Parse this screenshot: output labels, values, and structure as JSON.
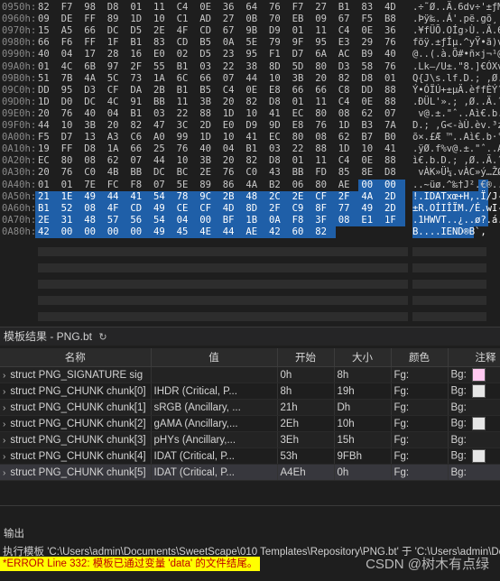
{
  "hex": {
    "rows": [
      {
        "addr": "0950h:",
        "bytes": [
          "82",
          "F7",
          "98",
          "D8",
          "01",
          "11",
          "C4",
          "0E",
          "36",
          "64",
          "76",
          "F7",
          "27",
          "B1",
          "83",
          "4D"
        ],
        "ascii": ".÷˜Ø..Ä.6dv÷'±ƒM"
      },
      {
        "addr": "0960h:",
        "bytes": [
          "09",
          "DE",
          "FF",
          "89",
          "1D",
          "10",
          "C1",
          "AD",
          "27",
          "0B",
          "70",
          "EB",
          "09",
          "67",
          "F5",
          "B8"
        ],
        "ascii": ".Þÿ‰..Á­'.pë.gõ¸"
      },
      {
        "addr": "0970h:",
        "bytes": [
          "15",
          "A5",
          "66",
          "DC",
          "D5",
          "2E",
          "4F",
          "CD",
          "67",
          "9B",
          "D9",
          "01",
          "11",
          "C4",
          "0E",
          "36"
        ],
        "ascii": ".¥fÜÕ.OÍg›Ù..Ä.6"
      },
      {
        "addr": "0980h:",
        "bytes": [
          "66",
          "F6",
          "FF",
          "1F",
          "B1",
          "83",
          "CD",
          "B5",
          "0A",
          "5E",
          "79",
          "9F",
          "95",
          "E3",
          "29",
          "76"
        ],
        "ascii": "föÿ.±ƒÍµ.^yŸ•ã)v"
      },
      {
        "addr": "0990h:",
        "bytes": [
          "40",
          "04",
          "17",
          "28",
          "16",
          "E0",
          "02",
          "D5",
          "23",
          "95",
          "F1",
          "D7",
          "6A",
          "AC",
          "B9",
          "40"
        ],
        "ascii": "@..(.à.Õ#•ñ×j¬¹@"
      },
      {
        "addr": "09A0h:",
        "bytes": [
          "01",
          "4C",
          "6B",
          "97",
          "2F",
          "55",
          "B1",
          "03",
          "22",
          "38",
          "8D",
          "5D",
          "80",
          "D3",
          "58",
          "76"
        ],
        "ascii": ".Lk—/U±.\"8.]€ÓXv"
      },
      {
        "addr": "09B0h:",
        "bytes": [
          "51",
          "7B",
          "4A",
          "5C",
          "73",
          "1A",
          "6C",
          "66",
          "07",
          "44",
          "10",
          "3B",
          "20",
          "82",
          "D8",
          "01"
        ],
        "ascii": "Q{J\\s.lf.D.; ‚Ø."
      },
      {
        "addr": "09C0h:",
        "bytes": [
          "DD",
          "95",
          "D3",
          "CF",
          "DA",
          "2B",
          "B1",
          "B5",
          "C4",
          "0E",
          "E8",
          "66",
          "66",
          "C8",
          "DD",
          "88"
        ],
        "ascii": "Ý•ÓÏÚ+±µÄ.èffÈÝˆ"
      },
      {
        "addr": "09D0h:",
        "bytes": [
          "1D",
          "D0",
          "DC",
          "4C",
          "91",
          "BB",
          "11",
          "3B",
          "20",
          "82",
          "D8",
          "01",
          "11",
          "C4",
          "0E",
          "88"
        ],
        "ascii": ".ÐÜL'».; ‚Ø..Ä.ˆ"
      },
      {
        "addr": "09E0h:",
        "bytes": [
          "20",
          "76",
          "40",
          "04",
          "B1",
          "03",
          "22",
          "88",
          "1D",
          "10",
          "41",
          "EC",
          "80",
          "08",
          "62",
          "07"
        ],
        "ascii": " v@.±.\"ˆ..Aì€.b."
      },
      {
        "addr": "09F0h:",
        "bytes": [
          "44",
          "10",
          "3B",
          "20",
          "82",
          "47",
          "3C",
          "2D",
          "E0",
          "D9",
          "9D",
          "E8",
          "76",
          "1D",
          "B3",
          "7A"
        ],
        "ascii": "D.; ‚G<-àÙ.èv.³z"
      },
      {
        "addr": "0A00h:",
        "bytes": [
          "F5",
          "D7",
          "13",
          "A3",
          "C6",
          "A0",
          "99",
          "1D",
          "10",
          "41",
          "EC",
          "80",
          "08",
          "62",
          "B7",
          "B0"
        ],
        "ascii": "õ×.£Æ ™..Aì€.b·°"
      },
      {
        "addr": "0A10h:",
        "bytes": [
          "19",
          "FF",
          "D8",
          "1A",
          "66",
          "25",
          "76",
          "40",
          "04",
          "B1",
          "03",
          "22",
          "88",
          "1D",
          "10",
          "41"
        ],
        "ascii": ".ÿØ.f%v@.±.\"ˆ..A"
      },
      {
        "addr": "0A20h:",
        "bytes": [
          "EC",
          "80",
          "08",
          "62",
          "07",
          "44",
          "10",
          "3B",
          "20",
          "82",
          "D8",
          "01",
          "11",
          "C4",
          "0E",
          "88"
        ],
        "ascii": "ì€.b.D.; ‚Ø..Ä.ˆ"
      },
      {
        "addr": "0A30h:",
        "bytes": [
          "20",
          "76",
          "C0",
          "4B",
          "BB",
          "DC",
          "BC",
          "2E",
          "76",
          "C0",
          "43",
          "BB",
          "FD",
          "85",
          "8E",
          "D8"
        ],
        "ascii": " vÀK»Ü¼.vÀC»ý…ŽØ"
      },
      {
        "addr": "0A40h:",
        "bytes": [
          "01",
          "01",
          "7E",
          "FC",
          "F8",
          "07",
          "5E",
          "89",
          "86",
          "4A",
          "B2",
          "06",
          "80",
          "AE",
          "00",
          "00"
        ],
        "ascii": "..~üø.^‰†J².€®.."
      },
      {
        "addr": "0A50h:",
        "bytes": [
          "21",
          "1E",
          "49",
          "44",
          "41",
          "54",
          "78",
          "9C",
          "2B",
          "48",
          "2C",
          "2E",
          "CF",
          "2F",
          "4A",
          "2D"
        ],
        "ascii": "!.IDATxœ+H,.Ï/J-"
      },
      {
        "addr": "0A60h:",
        "bytes": [
          "B1",
          "52",
          "08",
          "4F",
          "CD",
          "49",
          "CE",
          "CF",
          "4D",
          "8D",
          "2F",
          "C9",
          "8F",
          "77",
          "49",
          "2D"
        ],
        "ascii": "±R.OÍIÎÏM./É.wI-"
      },
      {
        "addr": "0A70h:",
        "bytes": [
          "2E",
          "31",
          "48",
          "57",
          "56",
          "54",
          "04",
          "00",
          "BF",
          "1B",
          "0A",
          "F8",
          "3F",
          "08",
          "E1",
          "1F"
        ],
        "ascii": ".1HWVT..¿..ø?.á."
      },
      {
        "addr": "0A80h:",
        "bytes": [
          "42",
          "00",
          "00",
          "00",
          "00",
          "49",
          "45",
          "4E",
          "44",
          "AE",
          "42",
          "60",
          "82"
        ],
        "ascii": "B....IEND®B`‚"
      }
    ]
  },
  "panel": {
    "title": "模板结果 - PNG.bt",
    "refresh_icon": "refresh-icon"
  },
  "table": {
    "headers": [
      "名称",
      "值",
      "开始",
      "大小",
      "颜色",
      "注释"
    ],
    "rows": [
      {
        "name": "struct PNG_SIGNATURE sig",
        "value": "",
        "start": "0h",
        "size": "8h",
        "fg": "Fg:",
        "bg": "Bg:",
        "bgcolor": "#ffc8f0"
      },
      {
        "name": "struct PNG_CHUNK chunk[0]",
        "value": "IHDR  (Critical, P...",
        "start": "8h",
        "size": "19h",
        "fg": "Fg:",
        "bg": "Bg:",
        "bgcolor": "#e6e6e6"
      },
      {
        "name": "struct PNG_CHUNK chunk[1]",
        "value": "sRGB  (Ancillary, ...",
        "start": "21h",
        "size": "Dh",
        "fg": "Fg:",
        "bg": "Bg:",
        "bgcolor": ""
      },
      {
        "name": "struct PNG_CHUNK chunk[2]",
        "value": "gAMA  (Ancillary,...",
        "start": "2Eh",
        "size": "10h",
        "fg": "Fg:",
        "bg": "Bg:",
        "bgcolor": "#e6e6e6"
      },
      {
        "name": "struct PNG_CHUNK chunk[3]",
        "value": "pHYs  (Ancillary,...",
        "start": "3Eh",
        "size": "15h",
        "fg": "Fg:",
        "bg": "Bg:",
        "bgcolor": ""
      },
      {
        "name": "struct PNG_CHUNK chunk[4]",
        "value": "IDAT  (Critical, P...",
        "start": "53h",
        "size": "9FBh",
        "fg": "Fg:",
        "bg": "Bg:",
        "bgcolor": "#e6e6e6"
      },
      {
        "name": "struct PNG_CHUNK chunk[5]",
        "value": "IDAT  (Critical, P...",
        "start": "A4Eh",
        "size": "0h",
        "fg": "Fg:",
        "bg": "Bg:",
        "bgcolor": ""
      }
    ]
  },
  "output": {
    "label": "输出",
    "run_line": "执行模板 'C:\\Users\\admin\\Documents\\SweetScape\\010 Templates\\Repository\\PNG.bt' 于 'C:\\Users\\admin\\Deskto",
    "error_line": "*ERROR Line 332: 模板已通过变量 'data' 的文件结尾。"
  },
  "watermark": "CSDN @树木有点绿",
  "colors": {
    "selection": "#1f5fa8",
    "error_bg": "#ffff00",
    "error_fg": "#c00000"
  }
}
